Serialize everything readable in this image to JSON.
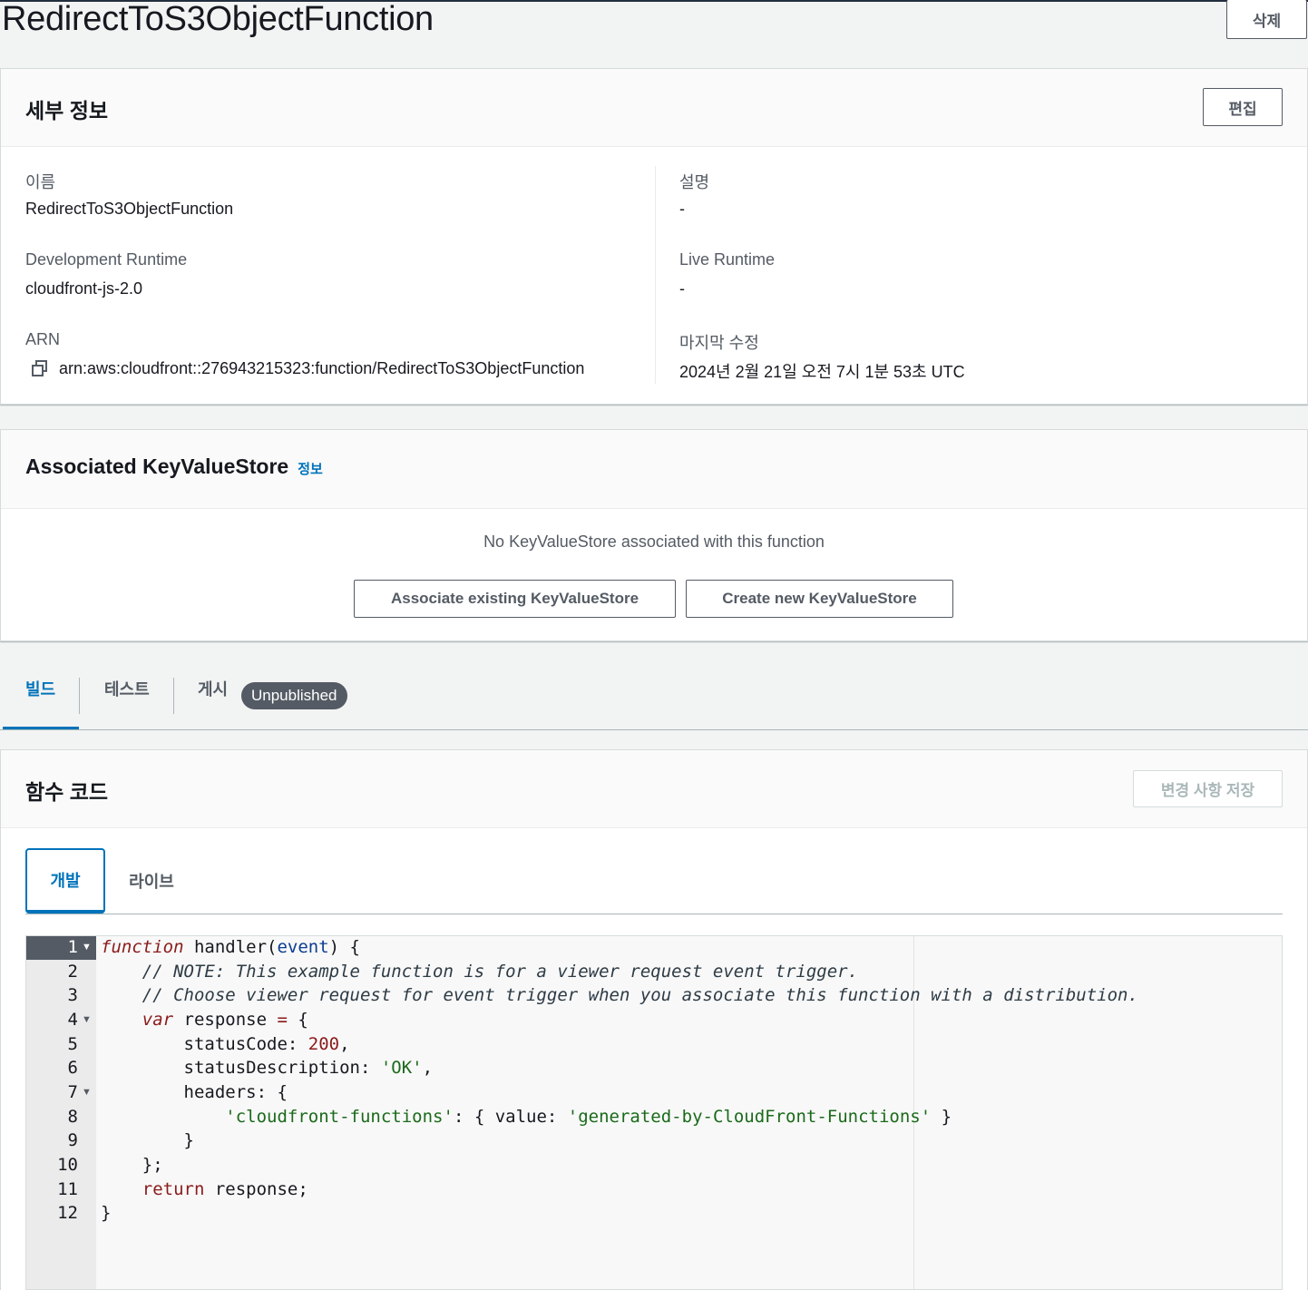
{
  "page": {
    "title": "RedirectToS3ObjectFunction",
    "delete_label": "삭제"
  },
  "details": {
    "title": "세부 정보",
    "edit_label": "편집",
    "name_label": "이름",
    "name_value": "RedirectToS3ObjectFunction",
    "description_label": "설명",
    "description_value": "-",
    "dev_runtime_label": "Development Runtime",
    "dev_runtime_value": "cloudfront-js-2.0",
    "live_runtime_label": "Live Runtime",
    "live_runtime_value": "-",
    "arn_label": "ARN",
    "arn_value": "arn:aws:cloudfront::276943215323:function/RedirectToS3ObjectFunction",
    "modified_label": "마지막 수정",
    "modified_value": "2024년 2월 21일 오전 7시 1분 53초 UTC"
  },
  "kvs": {
    "title": "Associated KeyValueStore",
    "info_label": "정보",
    "empty_message": "No KeyValueStore associated with this function",
    "associate_label": "Associate existing KeyValueStore",
    "create_label": "Create new KeyValueStore"
  },
  "tabs": {
    "build": "빌드",
    "test": "테스트",
    "publish": "게시",
    "publish_badge": "Unpublished"
  },
  "code": {
    "title": "함수 코드",
    "save_label": "변경 사항 저장",
    "dev_tab": "개발",
    "live_tab": "라이브",
    "line_numbers": [
      "1",
      "2",
      "3",
      "4",
      "5",
      "6",
      "7",
      "8",
      "9",
      "10",
      "11",
      "12"
    ]
  },
  "icons": {
    "copy": "copy-icon",
    "fold": "fold-arrow-icon"
  },
  "colors": {
    "accent": "#0073bb",
    "badge_bg": "#545b64",
    "background": "#f2f3f3"
  }
}
